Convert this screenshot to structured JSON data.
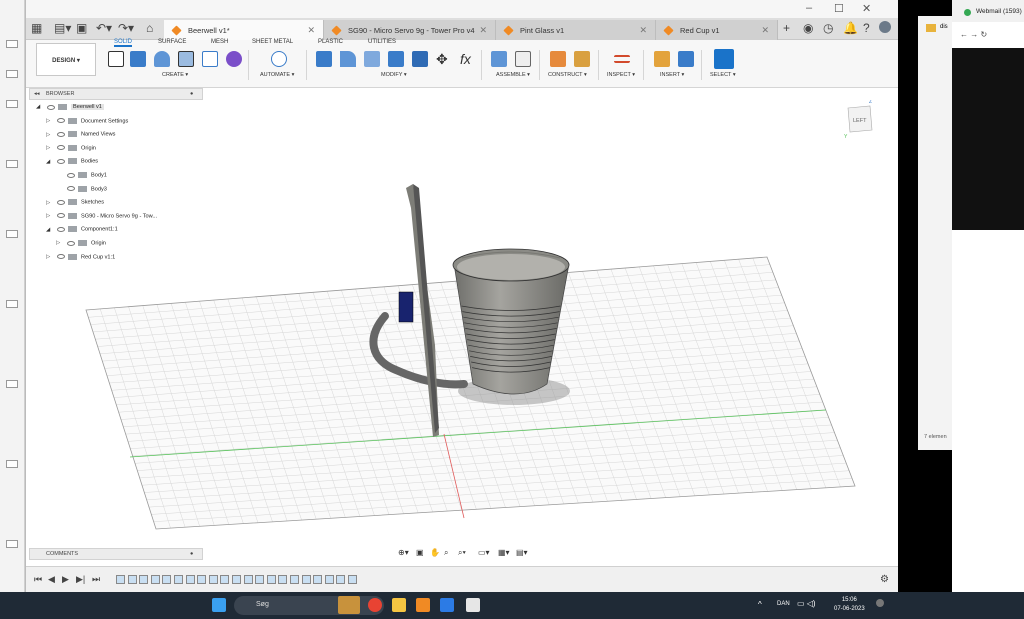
{
  "window": {
    "tabs": [
      {
        "label": "Beerwell v1*",
        "active": true
      },
      {
        "label": "SG90 - Micro Servo 9g - Tower Pro v4",
        "active": false
      },
      {
        "label": "Pint Glass v1",
        "active": false
      },
      {
        "label": "Red Cup v1",
        "active": false
      }
    ]
  },
  "toolbar": {
    "workspace": "DESIGN ▾",
    "tabs": [
      "SOLID",
      "SURFACE",
      "MESH",
      "SHEET METAL",
      "PLASTIC",
      "UTILITIES"
    ],
    "groups": [
      "CREATE ▾",
      "AUTOMATE ▾",
      "MODIFY ▾",
      "ASSEMBLE ▾",
      "CONSTRUCT ▾",
      "INSPECT ▾",
      "INSERT ▾",
      "SELECT ▾"
    ]
  },
  "browser": {
    "title": "BROWSER",
    "items": [
      {
        "label": "Beerwell v1",
        "depth": 0,
        "arrow": "◢"
      },
      {
        "label": "Document Settings",
        "depth": 1,
        "arrow": "▷"
      },
      {
        "label": "Named Views",
        "depth": 1,
        "arrow": "▷"
      },
      {
        "label": "Origin",
        "depth": 1,
        "arrow": "▷"
      },
      {
        "label": "Bodies",
        "depth": 1,
        "arrow": "◢"
      },
      {
        "label": "Body1",
        "depth": 2,
        "arrow": ""
      },
      {
        "label": "Body3",
        "depth": 2,
        "arrow": ""
      },
      {
        "label": "Sketches",
        "depth": 1,
        "arrow": "▷"
      },
      {
        "label": "SG90 - Micro Servo 9g - Tow...",
        "depth": 1,
        "arrow": "▷"
      },
      {
        "label": "Component1:1",
        "depth": 1,
        "arrow": "◢"
      },
      {
        "label": "Origin",
        "depth": 2,
        "arrow": "▷"
      },
      {
        "label": "Red Cup v1:1",
        "depth": 1,
        "arrow": "▷"
      }
    ]
  },
  "comments": {
    "title": "COMMENTS"
  },
  "viewcube": {
    "face": "LEFT",
    "axis_z": "Z",
    "axis_y": "Y"
  },
  "right_panel": {
    "tab": "Webmail (1593)",
    "partial_label": "dis",
    "footer": "7 elemen"
  },
  "taskbar": {
    "search_placeholder": "Søg",
    "language": "DAN",
    "time": "15:06",
    "date": "07-06-2023"
  },
  "colors": {
    "accent": "#1a73c9",
    "tab_icon": "#f08a24",
    "taskbar": "#1f2a36"
  }
}
